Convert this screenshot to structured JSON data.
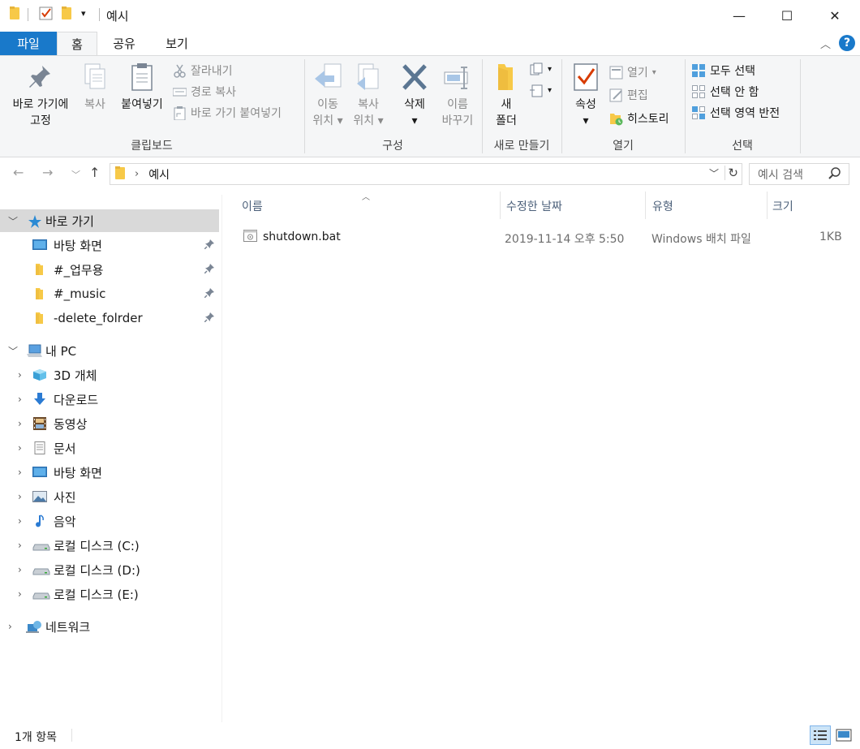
{
  "window": {
    "title": "예시",
    "minimize": "—",
    "maximize": "☐",
    "close": "✕"
  },
  "ribbon_tabs": {
    "file": "파일",
    "home": "홈",
    "share": "공유",
    "view": "보기"
  },
  "ribbon": {
    "clipboard": {
      "label": "클립보드",
      "pin_line1": "바로 가기에",
      "pin_line2": "고정",
      "copy": "복사",
      "paste": "붙여넣기",
      "cut": "잘라내기",
      "copy_path": "경로 복사",
      "paste_shortcut": "바로 가기 붙여넣기"
    },
    "organize": {
      "label": "구성",
      "move_line1": "이동",
      "move_line2": "위치",
      "copy_line1": "복사",
      "copy_line2": "위치",
      "delete": "삭제",
      "rename_line1": "이름",
      "rename_line2": "바꾸기"
    },
    "new": {
      "label": "새로 만들기",
      "folder_line1": "새",
      "folder_line2": "폴더"
    },
    "open": {
      "label": "열기",
      "properties": "속성",
      "open": "열기",
      "edit": "편집",
      "history": "히스토리"
    },
    "select": {
      "label": "선택",
      "select_all": "모두 선택",
      "select_none": "선택 안 함",
      "invert": "선택 영역 반전"
    }
  },
  "address": {
    "path": "예시",
    "search_placeholder": "예시 검색"
  },
  "nav": {
    "quick_access": "바로 가기",
    "pinned": [
      {
        "label": "바탕 화면",
        "icon": "desktop-icon"
      },
      {
        "label": "#_업무용",
        "icon": "folder-icon"
      },
      {
        "label": "#_music",
        "icon": "folder-icon"
      },
      {
        "label": "-delete_folrder",
        "icon": "folder-icon"
      }
    ],
    "this_pc": "내 PC",
    "pc_items": [
      {
        "label": "3D 개체",
        "icon": "3d-objects-icon"
      },
      {
        "label": "다운로드",
        "icon": "download-icon"
      },
      {
        "label": "동영상",
        "icon": "video-icon"
      },
      {
        "label": "문서",
        "icon": "document-icon"
      },
      {
        "label": "바탕 화면",
        "icon": "desktop-icon"
      },
      {
        "label": "사진",
        "icon": "picture-icon"
      },
      {
        "label": "음악",
        "icon": "music-icon"
      },
      {
        "label": "로컬 디스크 (C:)",
        "icon": "drive-icon"
      },
      {
        "label": "로컬 디스크 (D:)",
        "icon": "drive-icon"
      },
      {
        "label": "로컬 디스크 (E:)",
        "icon": "drive-icon"
      }
    ],
    "network": "네트워크"
  },
  "columns": {
    "name": "이름",
    "modified": "수정한 날짜",
    "type": "유형",
    "size": "크기"
  },
  "files": [
    {
      "name": "shutdown.bat",
      "modified": "2019-11-14 오후 5:50",
      "type": "Windows 배치 파일",
      "size": "1KB"
    }
  ],
  "status": {
    "count": "1개 항목"
  },
  "colors": {
    "accent": "#1979ca",
    "folder": "#f7c948",
    "ribbon_bg": "#f5f6f7",
    "selected": "#d9d9d9"
  }
}
